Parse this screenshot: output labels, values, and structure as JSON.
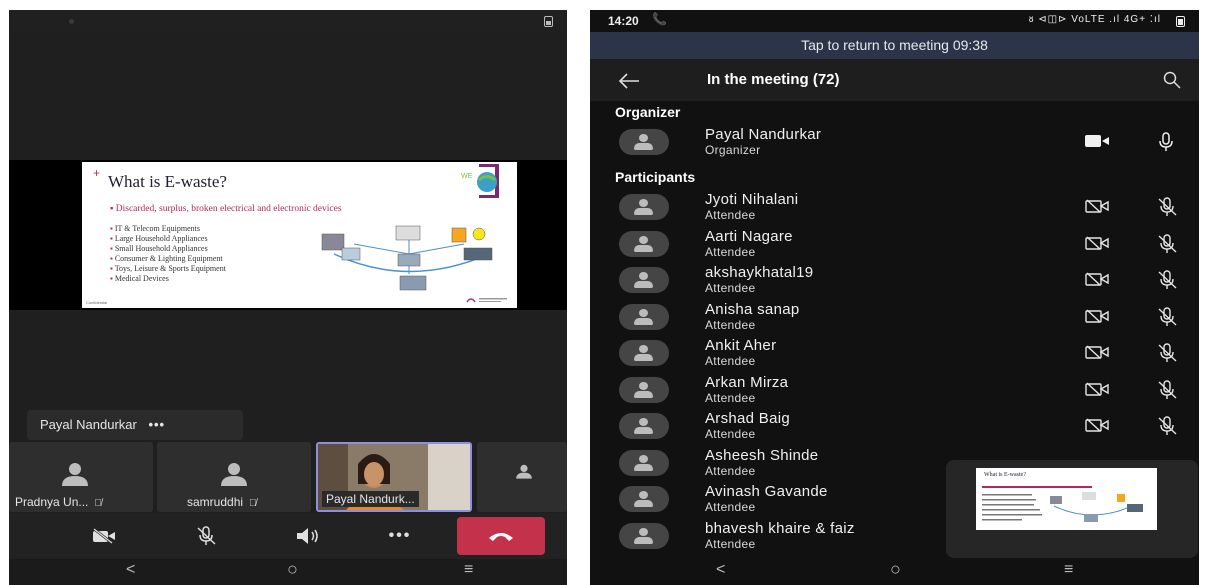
{
  "left": {
    "slide": {
      "title": "What is E-waste?",
      "subtitle": "Discarded, surplus, broken electrical and electronic devices",
      "items": [
        "IT & Telecom Equipments",
        "Large Household Appliances",
        "Small Household Appliances",
        "Consumer & Lighting Equipment",
        "Toys, Leisure & Sports Equipment",
        "Medical Devices"
      ],
      "footer": "Confidential"
    },
    "presenter": {
      "name": "Payal Nandurkar",
      "more": "•••"
    },
    "tiles": [
      {
        "name": "Pradnya Un...",
        "muted_icon": "mic-off-icon"
      },
      {
        "name": "samruddhi",
        "muted_icon": "mic-off-icon"
      },
      {
        "name": "Payal Nandurk..."
      }
    ],
    "toolbar": {
      "camera": "camera-off-icon",
      "mic": "mic-off-icon",
      "speaker": "speaker-icon",
      "more": "•••",
      "end": "end-call-icon"
    },
    "nav": {
      "back": "<",
      "home": "○",
      "recents": "≡"
    }
  },
  "right": {
    "status": {
      "time": "14:20",
      "indicators": "ᴕ ⊲◫⊳ VoLTE .ıl 4G+ ⁚ıl"
    },
    "banner": "Tap to return to meeting 09:38",
    "header_title": "In the meeting (72)",
    "organizer_heading": "Organizer",
    "organizer": {
      "name": "Payal Nandurkar",
      "role": "Organizer"
    },
    "participants_heading": "Participants",
    "participants": [
      {
        "name": "Jyoti Nihalani",
        "role": "Attendee"
      },
      {
        "name": "Aarti Nagare",
        "role": "Attendee"
      },
      {
        "name": "akshaykhatal19",
        "role": "Attendee"
      },
      {
        "name": "Anisha sanap",
        "role": "Attendee"
      },
      {
        "name": "Ankit Aher",
        "role": "Attendee"
      },
      {
        "name": "Arkan Mirza",
        "role": "Attendee"
      },
      {
        "name": "Arshad Baig",
        "role": "Attendee"
      },
      {
        "name": "Asheesh Shinde",
        "role": "Attendee"
      },
      {
        "name": "Avinash Gavande",
        "role": "Attendee"
      },
      {
        "name": "bhavesh khaire & faiz",
        "role": "Attendee"
      }
    ],
    "pip_title": "What is E-waste?",
    "nav": {
      "back": "<",
      "home": "○",
      "recents": "≡"
    }
  }
}
